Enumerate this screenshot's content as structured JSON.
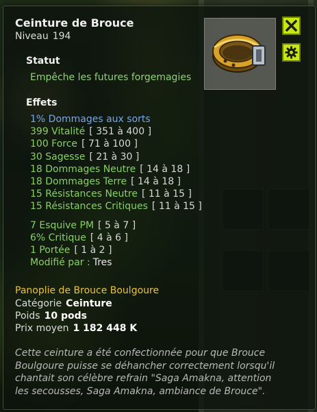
{
  "item": {
    "name": "Ceinture de Brouce",
    "level_label": "Niveau",
    "level": "194"
  },
  "statut": {
    "heading": "Statut",
    "text": "Empêche les futures forgemagies"
  },
  "effets": {
    "heading": "Effets",
    "lines": [
      {
        "text": "1% Dommages aux sorts",
        "range": "",
        "color": "#78a7e8"
      },
      {
        "text": "399 Vitalité",
        "range": "[ 351 à 400 ]",
        "color": "#89cf66"
      },
      {
        "text": "100 Force",
        "range": "[ 71 à 100 ]",
        "color": "#89cf66"
      },
      {
        "text": "30 Sagesse",
        "range": "[ 21 à 30 ]",
        "color": "#89cf66"
      },
      {
        "text": "18 Dommages Neutre",
        "range": "[ 14 à 18 ]",
        "color": "#89cf66"
      },
      {
        "text": "18 Dommages Terre",
        "range": "[ 14 à 18 ]",
        "color": "#89cf66"
      },
      {
        "text": "15 Résistances Neutre",
        "range": "[ 11 à 15 ]",
        "color": "#89cf66"
      },
      {
        "text": "15 Résistances Critiques",
        "range": "[ 11 à 15 ]",
        "color": "#89cf66"
      },
      {
        "text": "7 Esquive PM",
        "range": "[ 5 à 7 ]",
        "color": "#89cf66"
      },
      {
        "text": "6% Critique",
        "range": "[ 4 à 6 ]",
        "color": "#89cf66"
      },
      {
        "text": "1 Portée",
        "range": "[ 1 à 2 ]",
        "color": "#89cf66"
      }
    ],
    "modified_label": "Modifié par :",
    "modified_by": "Tres"
  },
  "panoplie": "Panoplie de Brouce Boulgoure",
  "info": {
    "categorie_label": "Catégorie",
    "categorie": "Ceinture",
    "poids_label": "Poids",
    "poids": "10 pods",
    "prix_label": "Prix moyen",
    "prix": "1 182 448 K"
  },
  "description": "Cette ceinture a été confectionnée pour que Brouce Boulgoure puisse se déhancher correctement lorsqu'il chantait son célèbre refrain \"Saga Amakna, attention les secousses, Saga Amakna, ambiance de Brouce\".",
  "buttons": {
    "close_icon": "close-icon",
    "settings_icon": "gear-icon"
  },
  "colors": {
    "accent_button": "#c7e615",
    "set_name": "#eec23b",
    "effect_green": "#89cf66",
    "effect_blue": "#78a7e8"
  }
}
